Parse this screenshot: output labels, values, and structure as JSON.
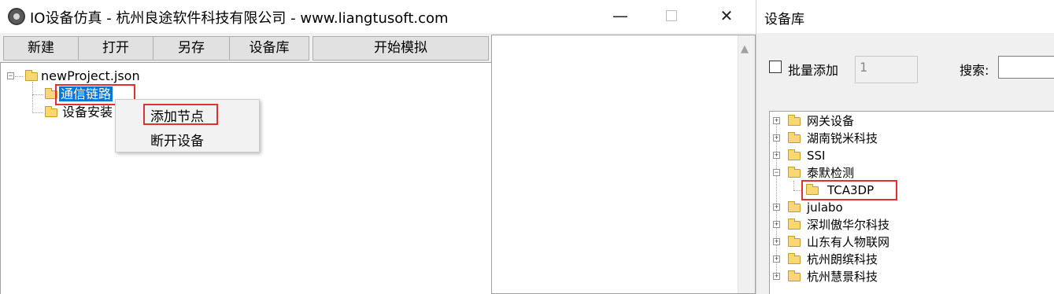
{
  "window": {
    "title": "IO设备仿真 - 杭州良途软件科技有限公司 - www.liangtusoft.com",
    "minimize": "—",
    "close": "✕"
  },
  "toolbar": {
    "new_label": "新建",
    "open_label": "打开",
    "save_as_label": "另存",
    "device_lib_label": "设备库",
    "start_sim_label": "开始模拟"
  },
  "tree": {
    "root": "newProject.json",
    "children": [
      "通信链路",
      "设备安装"
    ],
    "expander_minus": "−"
  },
  "context_menu": {
    "items": [
      "添加节点",
      "断开设备"
    ]
  },
  "device_library": {
    "title": "设备库",
    "batch_add_label": "批量添加",
    "batch_count": "1",
    "search_label": "搜索:",
    "search_value": "",
    "items": [
      "网关设备",
      "湖南锐米科技",
      "SSI",
      "泰默检测",
      "julabo",
      "深圳傲华尔科技",
      "山东有人物联网",
      "杭州朗缤科技",
      "杭州慧景科技"
    ],
    "sub_item": "TCA3DP",
    "expander_plus": "+",
    "expander_minus": "−"
  },
  "icons": {
    "app": "app-logo-icon",
    "folder": "folder-icon",
    "scroll_up": "chevron-up-icon"
  }
}
